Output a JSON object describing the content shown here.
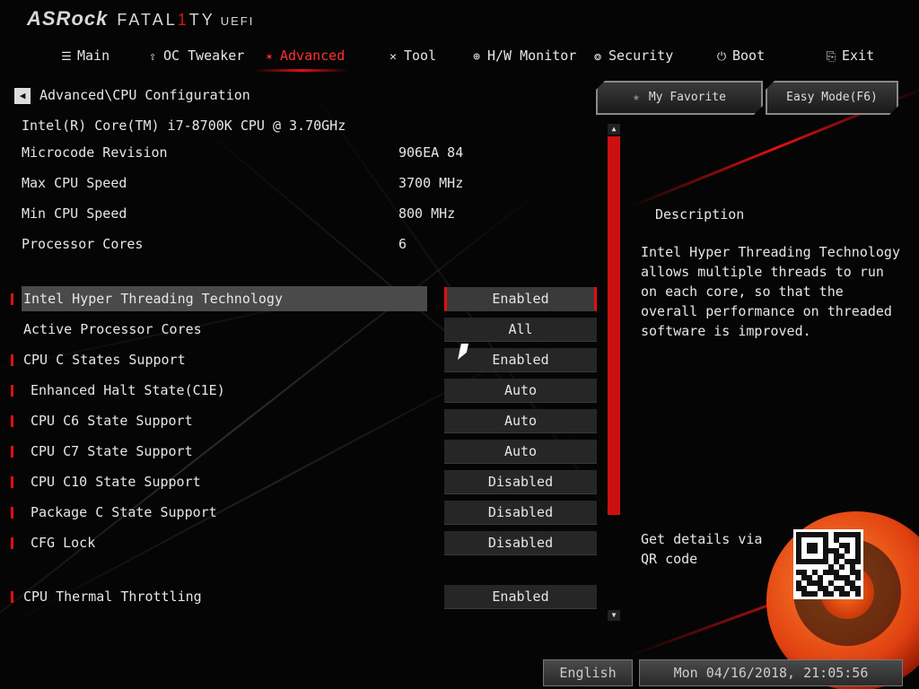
{
  "brand": {
    "name": "ASRock",
    "series": "FATAL",
    "series_one": "1",
    "series_end": "TY",
    "suffix": "UEFI"
  },
  "nav": [
    {
      "label": "Main",
      "icon": "list-icon"
    },
    {
      "label": "OC Tweaker",
      "icon": "rocket-icon"
    },
    {
      "label": "Advanced",
      "icon": "star-icon",
      "active": true
    },
    {
      "label": "Tool",
      "icon": "tools-icon"
    },
    {
      "label": "H/W Monitor",
      "icon": "crosshair-icon"
    },
    {
      "label": "Security",
      "icon": "shield-icon"
    },
    {
      "label": "Boot",
      "icon": "power-icon"
    },
    {
      "label": "Exit",
      "icon": "exit-icon"
    }
  ],
  "breadcrumb": "Advanced\\CPU Configuration",
  "buttons": {
    "favorite": "My Favorite",
    "easy_mode": "Easy Mode(F6)"
  },
  "cpu_name": "Intel(R) Core(TM) i7-8700K CPU @ 3.70GHz",
  "info": [
    {
      "label": "Microcode Revision",
      "value": "906EA 84"
    },
    {
      "label": "Max CPU Speed",
      "value": "3700 MHz"
    },
    {
      "label": "Min CPU Speed",
      "value": "800 MHz"
    },
    {
      "label": "Processor Cores",
      "value": "6"
    }
  ],
  "settings": [
    {
      "label": "Intel Hyper Threading Technology",
      "value": "Enabled",
      "selected": true
    },
    {
      "label": "Active Processor Cores",
      "value": "All"
    },
    {
      "label": "CPU C States Support",
      "value": "Enabled"
    },
    {
      "label": "Enhanced Halt State(C1E)",
      "value": "Auto"
    },
    {
      "label": "CPU C6 State Support",
      "value": "Auto"
    },
    {
      "label": "CPU C7 State Support",
      "value": "Auto"
    },
    {
      "label": "CPU C10 State Support",
      "value": "Disabled"
    },
    {
      "label": "Package C State Support",
      "value": "Disabled"
    },
    {
      "label": "CFG Lock",
      "value": "Disabled"
    },
    {
      "label": "CPU Thermal Throttling",
      "value": "Enabled"
    }
  ],
  "description": {
    "title": "Description",
    "text": "Intel Hyper Threading Technology allows multiple threads to run on each core, so that the overall performance on threaded software is improved."
  },
  "qr_text": "Get details via QR code",
  "footer": {
    "language": "English",
    "datetime": "Mon 04/16/2018, 21:05:56"
  },
  "colors": {
    "accent": "#e01010",
    "background": "#050505",
    "text": "#e6e6e6",
    "selected_row": "#4a4a4a"
  }
}
